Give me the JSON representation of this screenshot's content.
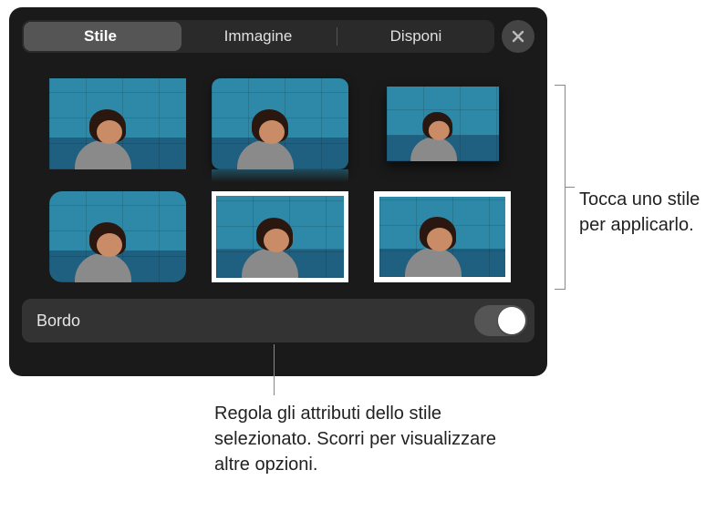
{
  "header": {
    "tabs": [
      {
        "label": "Stile",
        "selected": true
      },
      {
        "label": "Immagine",
        "selected": false
      },
      {
        "label": "Disponi",
        "selected": false
      }
    ],
    "close_icon": "close-icon"
  },
  "styles_grid": {
    "items": [
      {
        "name": "style-plain"
      },
      {
        "name": "style-rounded-shadow"
      },
      {
        "name": "style-small-shadow"
      },
      {
        "name": "style-rounded"
      },
      {
        "name": "style-white-border"
      },
      {
        "name": "style-stacked-white"
      }
    ]
  },
  "control": {
    "label": "Bordo",
    "switch_on": false
  },
  "callouts": {
    "right": "Tocca uno stile per applicarlo.",
    "bottom": "Regola gli attributi dello stile selezionato. Scorri per visualizzare altre opzioni."
  }
}
